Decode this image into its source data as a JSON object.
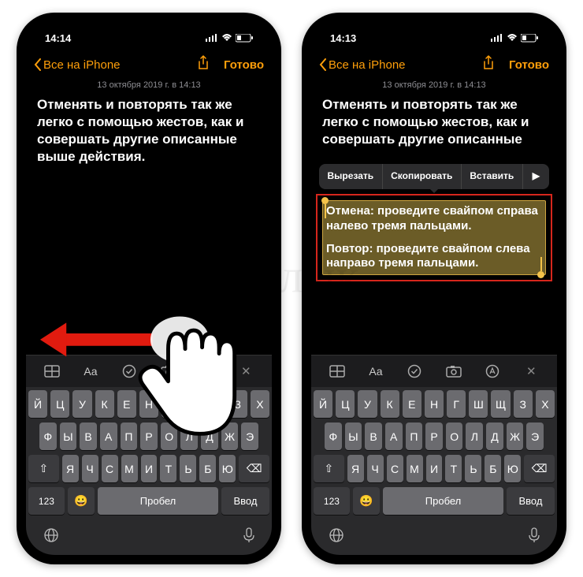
{
  "watermark": "Яблык",
  "phones": [
    {
      "status_time": "14:14",
      "nav_back": "Все на iPhone",
      "nav_done": "Готово",
      "timestamp": "13 октября 2019 г. в 14:13",
      "body": "Отменять и повторять так же легко с помощью жестов, как и совершать другие описанные выше действия.",
      "arrow_color": "#e11b0f"
    },
    {
      "status_time": "14:13",
      "nav_back": "Все на iPhone",
      "nav_done": "Готово",
      "timestamp": "13 октября 2019 г. в 14:13",
      "body_top": "Отменять и повторять так же легко с помощью жестов, как и совершать другие описанные",
      "context_menu": [
        "Вырезать",
        "Скопировать",
        "Вставить",
        "▶"
      ],
      "selection_p1": "Отмена: проведите свайпом справа налево тремя пальцами.",
      "selection_p2": "Повтор: проведите свайпом слева направо тремя пальцами."
    }
  ],
  "keyboard": {
    "toolbar_icons": [
      "table-icon",
      "text-format-icon",
      "checkmark-icon",
      "camera-icon",
      "annotate-icon",
      "close-icon"
    ],
    "rows": [
      [
        "Й",
        "Ц",
        "У",
        "К",
        "Е",
        "Н",
        "Г",
        "Ш",
        "Щ",
        "З",
        "Х"
      ],
      [
        "Ф",
        "Ы",
        "В",
        "А",
        "П",
        "Р",
        "О",
        "Л",
        "Д",
        "Ж",
        "Э"
      ],
      [
        "Я",
        "Ч",
        "С",
        "М",
        "И",
        "Т",
        "Ь",
        "Б",
        "Ю"
      ]
    ],
    "shift_icon": "⇧",
    "backspace_icon": "⌫",
    "num_label": "123",
    "emoji_icon": "😀",
    "space_label": "Пробел",
    "enter_label": "Ввод",
    "globe_icon": "🌐",
    "mic_icon": "🎤"
  }
}
